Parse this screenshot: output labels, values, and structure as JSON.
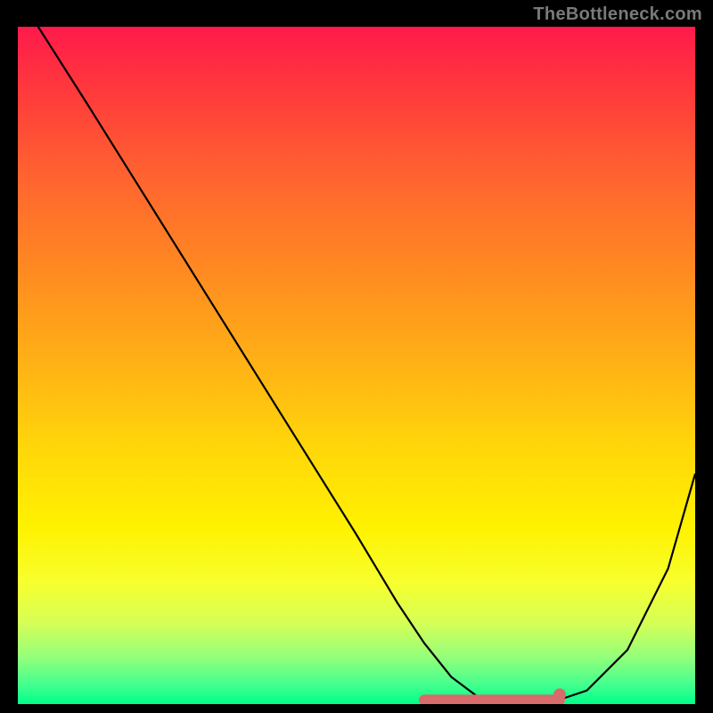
{
  "brand": "TheBottleneck.com",
  "chart_data": {
    "type": "line",
    "title": "",
    "xlabel": "",
    "ylabel": "",
    "xlim": [
      0,
      100
    ],
    "ylim": [
      0,
      100
    ],
    "series": [
      {
        "name": "bottleneck-curve",
        "x": [
          3,
          10,
          20,
          30,
          40,
          50,
          56,
          60,
          64,
          68,
          72,
          78,
          84,
          90,
          96,
          100
        ],
        "values": [
          100,
          89,
          73,
          57,
          41,
          25,
          15,
          9,
          4,
          1,
          0,
          0,
          2,
          8,
          20,
          34
        ]
      }
    ],
    "flat_zone": {
      "x_start": 60,
      "x_end": 80,
      "y": 0.6
    },
    "flat_marker_color": "#d86b6b",
    "curve_color": "#000000"
  }
}
